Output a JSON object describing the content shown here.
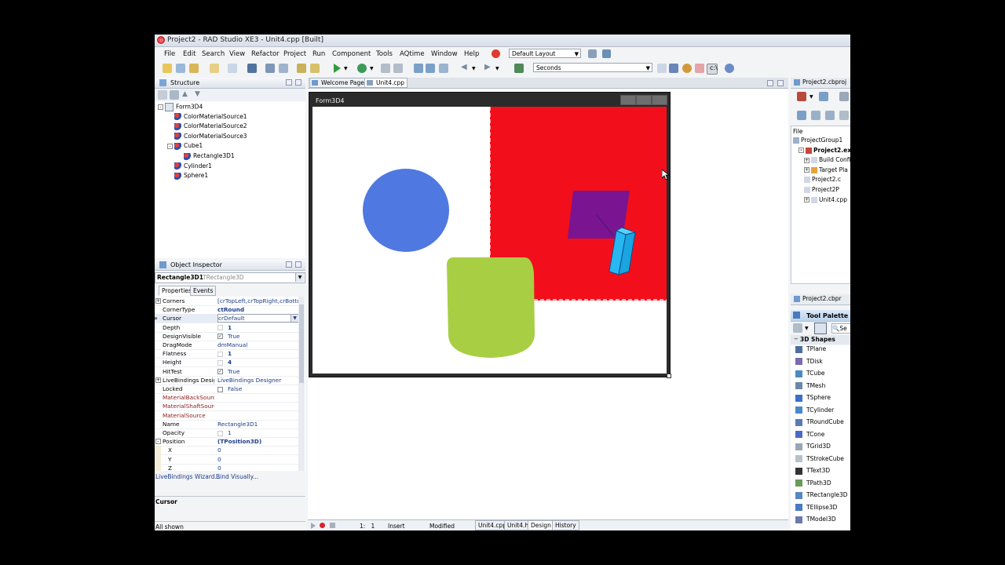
{
  "window": {
    "title": "Project2 - RAD Studio XE3 - Unit4.cpp [Built]"
  },
  "menu": [
    "File",
    "Edit",
    "Search",
    "View",
    "Refactor",
    "Project",
    "Run",
    "Component",
    "Tools",
    "AQtime",
    "Window",
    "Help"
  ],
  "layout_combo": "Default Layout",
  "units_combo": "Seconds",
  "structure": {
    "title": "Structure",
    "items": [
      {
        "label": "Form3D4",
        "indent": 0,
        "expander": "-"
      },
      {
        "label": "ColorMaterialSource1",
        "indent": 1,
        "expander": ""
      },
      {
        "label": "ColorMaterialSource2",
        "indent": 1,
        "expander": ""
      },
      {
        "label": "ColorMaterialSource3",
        "indent": 1,
        "expander": ""
      },
      {
        "label": "Cube1",
        "indent": 1,
        "expander": "-"
      },
      {
        "label": "Rectangle3D1",
        "indent": 2,
        "expander": ""
      },
      {
        "label": "Cylinder1",
        "indent": 1,
        "expander": ""
      },
      {
        "label": "Sphere1",
        "indent": 1,
        "expander": ""
      }
    ]
  },
  "inspector": {
    "title": "Object Inspector",
    "object_name": "Rectangle3D1",
    "object_type": "TRectangle3D",
    "tab_properties": "Properties",
    "tab_events": "Events",
    "properties": [
      {
        "name": "Corners",
        "value": "[crTopLeft,crTopRight,crBottc",
        "expander": "+",
        "bold": false,
        "red": false,
        "check": ""
      },
      {
        "name": "CornerType",
        "value": "ctRound",
        "expander": "",
        "bold": true,
        "red": false,
        "check": ""
      },
      {
        "name": "Cursor",
        "value": "crDefault",
        "expander": "",
        "bold": false,
        "red": false,
        "check": "",
        "selected": true
      },
      {
        "name": "Depth",
        "value": "1",
        "expander": "",
        "bold": true,
        "red": false,
        "check": "spin"
      },
      {
        "name": "DesignVisible",
        "value": "True",
        "expander": "",
        "bold": false,
        "red": false,
        "check": "on"
      },
      {
        "name": "DragMode",
        "value": "dmManual",
        "expander": "",
        "bold": false,
        "red": false,
        "check": ""
      },
      {
        "name": "Flatness",
        "value": "1",
        "expander": "",
        "bold": true,
        "red": false,
        "check": "spin"
      },
      {
        "name": "Height",
        "value": "4",
        "expander": "",
        "bold": true,
        "red": false,
        "check": "spin"
      },
      {
        "name": "HitTest",
        "value": "True",
        "expander": "",
        "bold": false,
        "red": false,
        "check": "on"
      },
      {
        "name": "LiveBindings Designer",
        "value": "LiveBindings Designer",
        "expander": "+",
        "bold": false,
        "red": false,
        "check": ""
      },
      {
        "name": "Locked",
        "value": "False",
        "expander": "",
        "bold": false,
        "red": false,
        "check": "off"
      },
      {
        "name": "MaterialBackSource",
        "value": "",
        "expander": "",
        "bold": false,
        "red": true,
        "check": ""
      },
      {
        "name": "MaterialShaftSource",
        "value": "",
        "expander": "",
        "bold": false,
        "red": true,
        "check": ""
      },
      {
        "name": "MaterialSource",
        "value": "",
        "expander": "",
        "bold": false,
        "red": true,
        "check": ""
      },
      {
        "name": "Name",
        "value": "Rectangle3D1",
        "expander": "",
        "bold": false,
        "red": false,
        "check": ""
      },
      {
        "name": "Opacity",
        "value": "1",
        "expander": "",
        "bold": false,
        "red": false,
        "check": "spin"
      },
      {
        "name": "Position",
        "value": "(TPosition3D)",
        "expander": "-",
        "bold": true,
        "red": false,
        "check": ""
      },
      {
        "name": "X",
        "value": "0",
        "expander": "",
        "bold": false,
        "red": false,
        "check": "",
        "sub": true
      },
      {
        "name": "Y",
        "value": "0",
        "expander": "",
        "bold": false,
        "red": false,
        "check": "",
        "sub": true
      },
      {
        "name": "Z",
        "value": "0",
        "expander": "",
        "bold": false,
        "red": false,
        "check": "",
        "sub": true
      }
    ],
    "livebindings_wizard": "LiveBindings Wizard...",
    "bind_visually": "Bind Visually...",
    "description_title": "Cursor",
    "status": "All shown"
  },
  "editor": {
    "tab_welcome": "Welcome Page",
    "tab_unit": "Unit4.cpp",
    "form_title": "Form3D4",
    "status_pos": "1:   1",
    "status_mode": "Insert",
    "status_state": "Modified",
    "bottom_tabs": [
      "Unit4.cpp",
      "Unit4.h",
      "Design",
      "History"
    ]
  },
  "project_manager": {
    "tab": "Project2.cbproj",
    "file_header": "File",
    "items": [
      {
        "label": "ProjectGroup1",
        "indent": 0,
        "bold": false,
        "expander": ""
      },
      {
        "label": "Project2.exe",
        "indent": 1,
        "bold": true,
        "expander": "-"
      },
      {
        "label": "Build Config",
        "indent": 2,
        "bold": false,
        "expander": "+"
      },
      {
        "label": "Target Pla",
        "indent": 2,
        "bold": false,
        "expander": "+"
      },
      {
        "label": "Project2.c",
        "indent": 2,
        "bold": false,
        "expander": ""
      },
      {
        "label": "Project2P",
        "indent": 2,
        "bold": false,
        "expander": ""
      },
      {
        "label": "Unit4.cpp",
        "indent": 2,
        "bold": false,
        "expander": "+"
      }
    ]
  },
  "tool_palette": {
    "tab": "Project2.cbpr",
    "title": "Tool Palette",
    "search_label": "Se",
    "category": "3D Shapes",
    "items": [
      "TPlane",
      "TDisk",
      "TCube",
      "TMesh",
      "TSphere",
      "TCylinder",
      "TRoundCube",
      "TCone",
      "TGrid3D",
      "TStrokeCube",
      "TText3D",
      "TPath3D",
      "TRectangle3D",
      "TEllipse3D",
      "TModel3D"
    ]
  },
  "colors": {
    "red_plane": "#f20f1b",
    "purple_rect": "#7a1490",
    "blue_sphere": "#4f78e0",
    "green_cylinder": "#a8ce44",
    "cyan_cube": "#27b8f2",
    "form_title_bg": "#2b2b2b"
  }
}
